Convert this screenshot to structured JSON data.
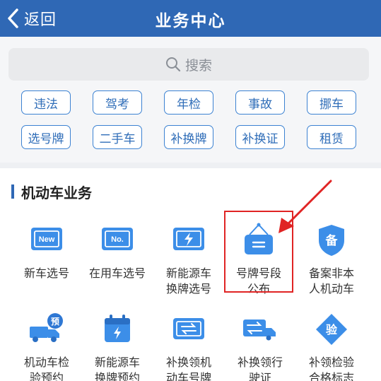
{
  "header": {
    "back_label": "返回",
    "title": "业务中心"
  },
  "search": {
    "placeholder": "搜索"
  },
  "quick_tags": [
    "违法",
    "驾考",
    "年检",
    "事故",
    "挪车",
    "选号牌",
    "二手车",
    "补换牌",
    "补换证",
    "租赁"
  ],
  "section": {
    "title": "机动车业务"
  },
  "items": [
    {
      "label": "新车选号",
      "icon": "new-plate-icon"
    },
    {
      "label": "在用车选号",
      "icon": "no-plate-icon"
    },
    {
      "label": "新能源车\n换牌选号",
      "icon": "ev-plate-icon"
    },
    {
      "label": "号牌号段\n公布",
      "icon": "plate-segment-sign-icon"
    },
    {
      "label": "备案非本\n人机动车",
      "icon": "filing-shield-icon"
    },
    {
      "label": "机动车检\n验预约",
      "icon": "inspection-truck-icon"
    },
    {
      "label": "新能源车\n换牌预约",
      "icon": "ev-calendar-icon"
    },
    {
      "label": "补换领机\n动车号牌",
      "icon": "plate-exchange-icon"
    },
    {
      "label": "补换领行\n驶证",
      "icon": "license-exchange-icon"
    },
    {
      "label": "补领检验\n合格标志",
      "icon": "inspection-badge-icon"
    }
  ],
  "colors": {
    "header": "#2f68b5",
    "accent": "#3c82d2",
    "highlight": "#e02424"
  }
}
